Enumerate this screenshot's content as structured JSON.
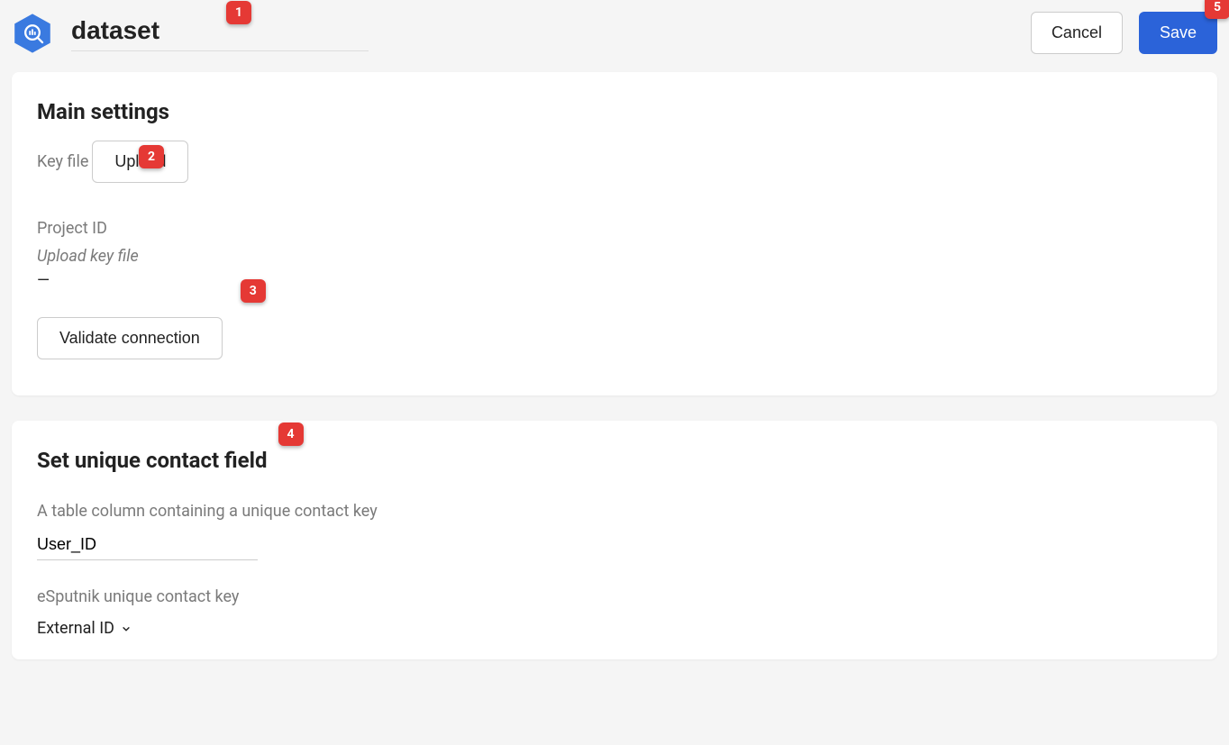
{
  "header": {
    "title_value": "dataset",
    "cancel_label": "Cancel",
    "save_label": "Save"
  },
  "main_settings": {
    "heading": "Main settings",
    "key_file_label": "Key file",
    "upload_label": "Upload",
    "project_id_label": "Project ID",
    "project_id_hint": "Upload key file",
    "project_id_value": "—",
    "validate_label": "Validate connection"
  },
  "unique_contact": {
    "heading": "Set unique contact field",
    "column_label": "A table column containing a unique contact key",
    "column_value": "User_ID",
    "esputnik_label": "eSputnik unique contact key",
    "esputnik_value": "External ID"
  },
  "badges": {
    "b1": "1",
    "b2": "2",
    "b3": "3",
    "b4": "4",
    "b5": "5"
  }
}
